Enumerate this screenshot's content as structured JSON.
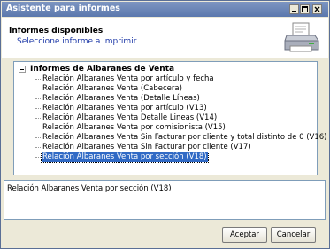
{
  "window": {
    "title": "Asistente para informes"
  },
  "titlebar_buttons": {
    "minimize": "_",
    "maximize": "□",
    "close": "X"
  },
  "header": {
    "title": "Informes disponibles",
    "subtitle": "Seleccione informe a imprimir",
    "icon": "printer-icon"
  },
  "tree": {
    "root_label": "Informes de Albaranes de Venta",
    "items": [
      {
        "label": "Relación Albaranes Venta por artículo y fecha"
      },
      {
        "label": "Relación Albaranes Venta (Cabecera)"
      },
      {
        "label": "Relación Albaranes Venta (Detalle Líneas)"
      },
      {
        "label": "Relación Albaranes Venta por artículo (V13)"
      },
      {
        "label": "Relación Albaranes Venta Detalle Lineas (V14)"
      },
      {
        "label": "Relación Albaranes Venta por comisionista (V15)"
      },
      {
        "label": "Relación Albaranes Venta Sin Facturar por cliente y total distinto de 0 (V16)"
      },
      {
        "label": "Relación Albaranes Venta Sin Facturar por cliente (V17)"
      },
      {
        "label": "Relación Albaranes Venta por sección (V18)"
      }
    ],
    "selected_index": 8
  },
  "description": {
    "text": "Relación Albaranes Venta por sección (V18)"
  },
  "buttons": {
    "accept": "Aceptar",
    "cancel": "Cancelar"
  },
  "colors": {
    "selection": "#316ac5",
    "titlebar": "#6a85b8",
    "subtitle": "#1f3aa8"
  }
}
